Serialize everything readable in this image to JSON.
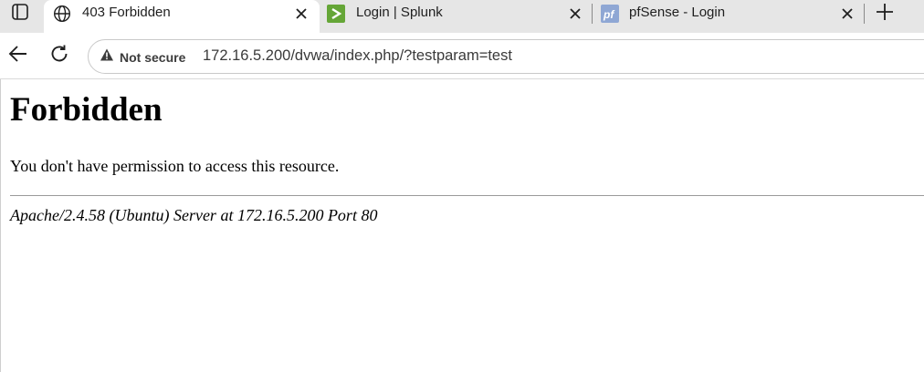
{
  "tabs": [
    {
      "title": "403 Forbidden",
      "icon": "globe-icon",
      "active": true
    },
    {
      "title": "Login | Splunk",
      "icon": "splunk-icon",
      "active": false
    },
    {
      "title": "pfSense - Login",
      "icon": "pfsense-icon",
      "active": false
    }
  ],
  "toolbar": {
    "security_label": "Not secure",
    "url": "172.16.5.200/dvwa/index.php/?testparam=test"
  },
  "page": {
    "heading": "Forbidden",
    "message": "You don't have permission to access this resource.",
    "server_signature": "Apache/2.4.58 (Ubuntu) Server at 172.16.5.200 Port 80"
  },
  "colors": {
    "tabstrip_bg": "#e6e6e6",
    "splunk_green": "#65a637",
    "pfsense_blue": "#8fa7d4"
  }
}
